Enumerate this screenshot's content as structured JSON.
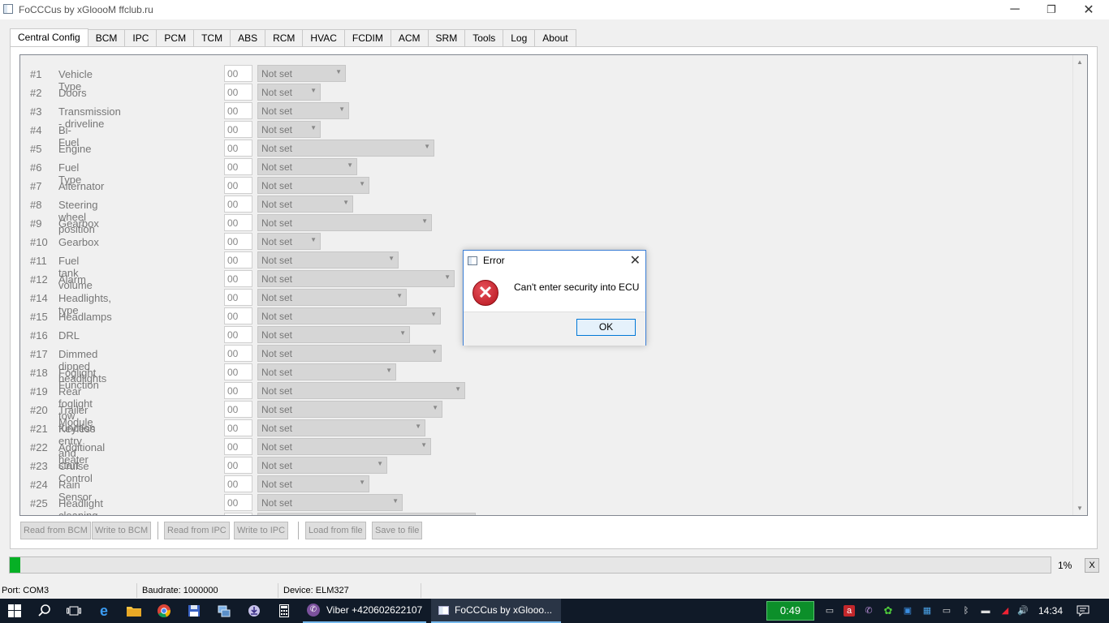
{
  "window": {
    "title": "FoCCCus by xGloooM ffclub.ru",
    "minimize": "─",
    "restore": "❐",
    "close": "✕"
  },
  "tabs": [
    "Central Config",
    "BCM",
    "IPC",
    "PCM",
    "TCM",
    "ABS",
    "RCM",
    "HVAC",
    "FCDIM",
    "ACM",
    "SRM",
    "Tools",
    "Log",
    "About"
  ],
  "active_tab": "Central Config",
  "config_rows": [
    {
      "num": "#1",
      "name": "Vehicle Type",
      "value": "00",
      "selected": "Not set"
    },
    {
      "num": "#2",
      "name": "Doors",
      "value": "00",
      "selected": "Not set"
    },
    {
      "num": "#3",
      "name": "Transmission - driveline",
      "value": "00",
      "selected": "Not set"
    },
    {
      "num": "#4",
      "name": "Bi-Fuel",
      "value": "00",
      "selected": "Not set"
    },
    {
      "num": "#5",
      "name": "Engine",
      "value": "00",
      "selected": "Not set"
    },
    {
      "num": "#6",
      "name": "Fuel Type",
      "value": "00",
      "selected": "Not set"
    },
    {
      "num": "#7",
      "name": "Alternator",
      "value": "00",
      "selected": "Not set"
    },
    {
      "num": "#8",
      "name": "Steering wheel position",
      "value": "00",
      "selected": "Not set"
    },
    {
      "num": "#9",
      "name": "Gearbox",
      "value": "00",
      "selected": "Not set"
    },
    {
      "num": "#10",
      "name": "Gearbox",
      "value": "00",
      "selected": "Not set"
    },
    {
      "num": "#11",
      "name": "Fuel tank volume",
      "value": "00",
      "selected": "Not set"
    },
    {
      "num": "#12",
      "name": "Alarm",
      "value": "00",
      "selected": "Not set"
    },
    {
      "num": "#14",
      "name": "Headlights, type",
      "value": "00",
      "selected": "Not set"
    },
    {
      "num": "#15",
      "name": "Headlamps",
      "value": "00",
      "selected": "Not set"
    },
    {
      "num": "#16",
      "name": "DRL",
      "value": "00",
      "selected": "Not set"
    },
    {
      "num": "#17",
      "name": "Dimmed dipped headlights",
      "value": "00",
      "selected": "Not set"
    },
    {
      "num": "#18",
      "name": "Foglight Function",
      "value": "00",
      "selected": "Not set"
    },
    {
      "num": "#19",
      "name": "Rear foglight tow function",
      "value": "00",
      "selected": "Not set"
    },
    {
      "num": "#20",
      "name": "Trailer Module",
      "value": "00",
      "selected": "Not set"
    },
    {
      "num": "#21",
      "name": "Keyless entry and start",
      "value": "00",
      "selected": "Not set"
    },
    {
      "num": "#22",
      "name": "Additional heater",
      "value": "00",
      "selected": "Not set"
    },
    {
      "num": "#23",
      "name": "Cruise Control",
      "value": "00",
      "selected": "Not set"
    },
    {
      "num": "#24",
      "name": "Rain Sensor",
      "value": "00",
      "selected": "Not set"
    },
    {
      "num": "#25",
      "name": "Headlight cleaning",
      "value": "00",
      "selected": "Not set"
    }
  ],
  "buttons": {
    "read_bcm": "Read from BCM",
    "write_bcm": "Write to BCM",
    "read_ipc": "Read from IPC",
    "write_ipc": "Write to IPC",
    "load_file": "Load from file",
    "save_file": "Save to file"
  },
  "progress": {
    "percent": 1,
    "label": "1%",
    "cancel": "X",
    "color": "#06b025"
  },
  "status": {
    "port": "Port: COM3",
    "baudrate": "Baudrate: 1000000",
    "device": "Device: ELM327"
  },
  "dialog": {
    "title": "Error",
    "close": "✕",
    "message": "Can't enter security into ECU",
    "ok": "OK",
    "icon_glyph": "✕",
    "icon": "error-icon"
  },
  "taskbar": {
    "apps": [
      {
        "label": "Viber +420602622107",
        "icon": "viber-icon"
      },
      {
        "label": "FoCCCus by xGlooo...",
        "icon": "app-icon"
      }
    ],
    "timer": "0:49",
    "clock": "14:34",
    "volume_glyph": "🔊"
  }
}
